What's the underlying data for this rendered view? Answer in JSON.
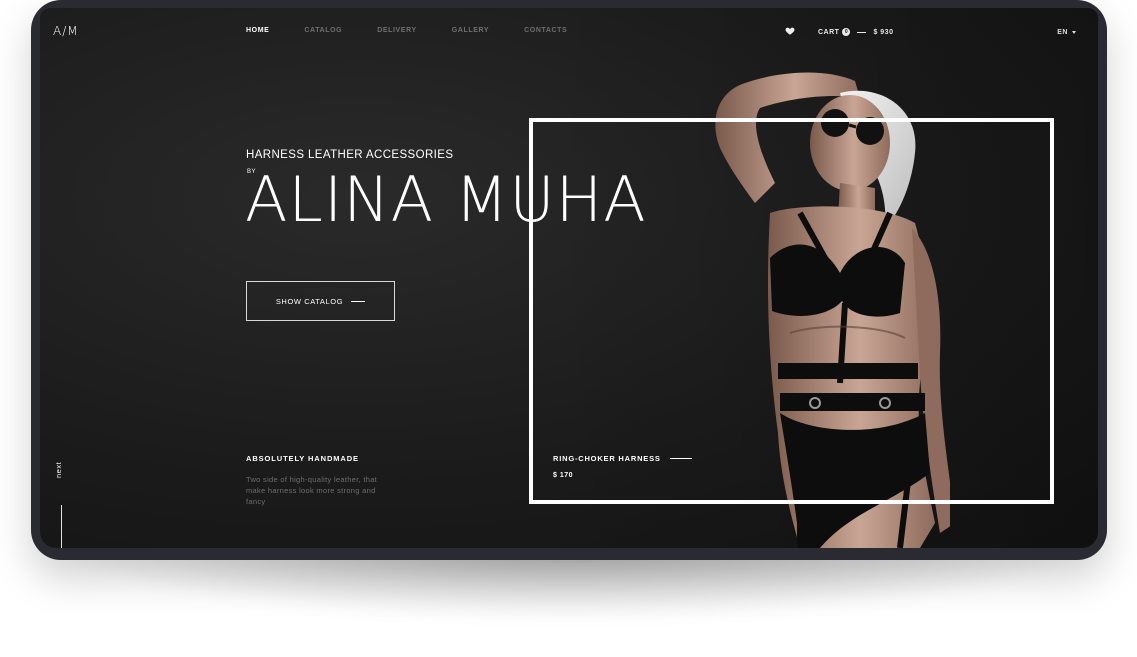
{
  "header": {
    "logo": "A/M",
    "nav": [
      {
        "label": "HOME",
        "active": true
      },
      {
        "label": "CATALOG",
        "active": false
      },
      {
        "label": "DELIVERY",
        "active": false
      },
      {
        "label": "GALLERY",
        "active": false
      },
      {
        "label": "CONTACTS",
        "active": false
      }
    ],
    "wishlist_icon": "heart-icon",
    "cart_label": "CART",
    "cart_count": "0",
    "cart_total": "$ 930",
    "language": "EN"
  },
  "hero": {
    "subtitle": "HARNESS LEATHER ACCESSORIES",
    "by": "BY",
    "title": "ALINA MUHA",
    "cta_label": "SHOW CATALOG"
  },
  "features": {
    "title": "ABSOLUTELY HANDMADE",
    "description": "Two side of high-quality leather, that make harness look more strong and fancy"
  },
  "product": {
    "name": "RING-CHOKER HARNESS",
    "price": "$ 170"
  },
  "side": {
    "next_label": "next"
  },
  "colors": {
    "background": "#1b1b1b",
    "device": "#2a2a33",
    "text": "#ffffff",
    "muted": "#6f6f6f"
  }
}
